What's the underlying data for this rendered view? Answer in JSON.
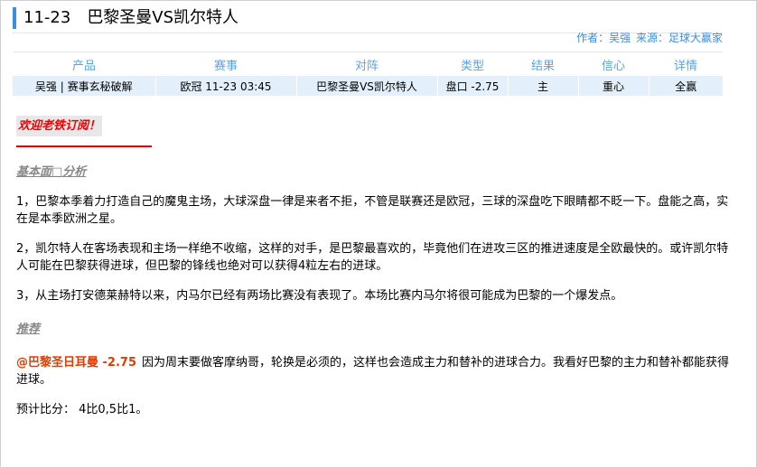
{
  "header": {
    "date": "11-23",
    "match_title": "巴黎圣曼VS凯尔特人",
    "author_label": "作者：吴强",
    "source_label": "来源：足球大赢家"
  },
  "table": {
    "headers": [
      "产品",
      "赛事",
      "对阵",
      "类型",
      "结果",
      "信心",
      "详情"
    ],
    "row": [
      "吴强 | 赛事玄秘破解",
      "欧冠 11-23 03:45",
      "巴黎圣曼VS凯尔特人",
      "盘口 -2.75",
      "主",
      "重心",
      "全赢"
    ]
  },
  "content": {
    "welcome": "欢迎老铁订阅！",
    "analysis_title": "基本面□分析",
    "paragraphs": [
      "1，巴黎本季着力打造自己的魔鬼主场，大球深盘一律是来者不拒，不管是联赛还是欧冠，三球的深盘吃下眼睛都不眨一下。盘能之高，实在是本季欧洲之星。",
      "2，凯尔特人在客场表现和主场一样绝不收缩，这样的对手，是巴黎最喜欢的，毕竟他们在进攻三区的推进速度是全欧最快的。或许凯尔特人可能在巴黎获得进球，但巴黎的锋线也绝对可以获得4粒左右的进球。",
      "3，从主场打安德莱赫特以来，内马尔已经有两场比赛没有表现了。本场比赛内马尔将很可能成为巴黎的一个爆发点。"
    ],
    "recommend_title": "推荐",
    "pick": "@巴黎圣日耳曼 -2.75",
    "pick_reason": "因为周末要做客摩纳哥，轮换是必须的，这样也会造成主力和替补的进球合力。我看好巴黎的主力和替补都能获得进球。",
    "score_prediction": "预计比分： 4比0,5比1。"
  },
  "colors": {
    "accent": "#3a8ee6",
    "header_text": "#5aa3e8",
    "row_bg": "#e3f0fb",
    "highlight": "#e00000",
    "pick": "#e53a00"
  }
}
